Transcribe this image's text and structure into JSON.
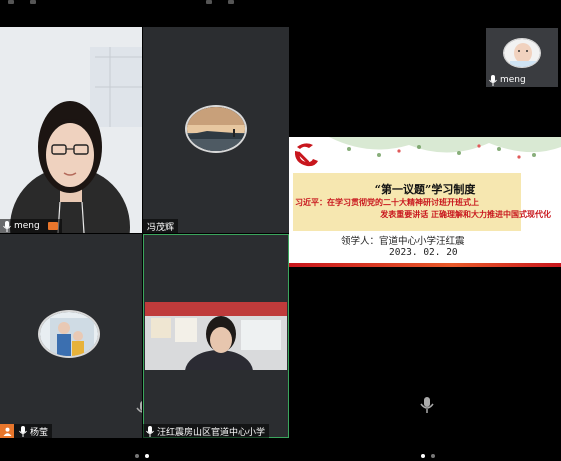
{
  "participants": {
    "tile1": {
      "name": "meng"
    },
    "tile2": {
      "name": "冯茂辉"
    },
    "tile3": {
      "name": "杨莹"
    },
    "tile4": {
      "name": "汪红震房山区官道中心小学"
    },
    "pip": {
      "name": "meng"
    }
  },
  "slide": {
    "title": "“第一议题”学习制度",
    "subtitle_line1": "习近平：在学习贯彻党的二十大精神研讨班开班式上",
    "subtitle_line2": "发表重要讲话 正确理解和大力推进中国式现代化",
    "leader": "领学人：官道中心小学汪红震",
    "date": "2023. 02. 20"
  },
  "colors": {
    "speaking_border": "#3ba55d",
    "tile_bg": "#2b2d30",
    "party_red": "#c8161d"
  },
  "icons": [
    "mic-icon",
    "person-icon",
    "party-emblem-icon"
  ]
}
